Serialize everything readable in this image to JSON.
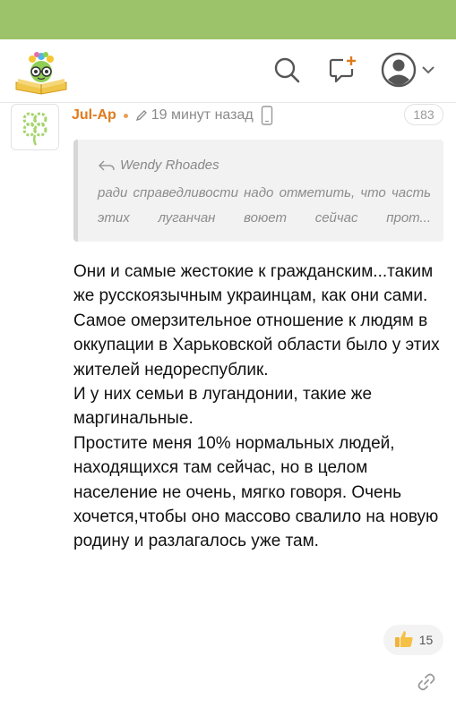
{
  "header": {
    "logo": "site-logo",
    "icons": [
      "search-icon",
      "new-post-icon",
      "account-icon",
      "chevron-down-icon"
    ]
  },
  "comment": {
    "author": "Jul-Ap",
    "time": "19 минут назад",
    "id": "183",
    "quote": {
      "author": "Wendy Rhoades",
      "text": "ради справедливости надо отметить, что часть этих луганчан воюет сейчас прот..."
    },
    "paragraphs": [
      "Они и самые жестокие к гражданским...таким же русскоязычным украинцам, как они сами.",
      "Самое омерзительное отношение к людям в оккупации в Харьковской области было у этих жителей недореспублик.",
      "И у них семьи в лугандонии, такие же маргинальные.",
      "Простите меня 10% нормальных людей, находящихся там сейчас, но в целом население не очень, мягко говоря. Очень хочется,чтобы оно массово свалило на новую родину и разлагалось уже там."
    ],
    "likes": "15"
  },
  "colors": {
    "topbar": "#9cc26a",
    "author": "#e07a1d"
  }
}
